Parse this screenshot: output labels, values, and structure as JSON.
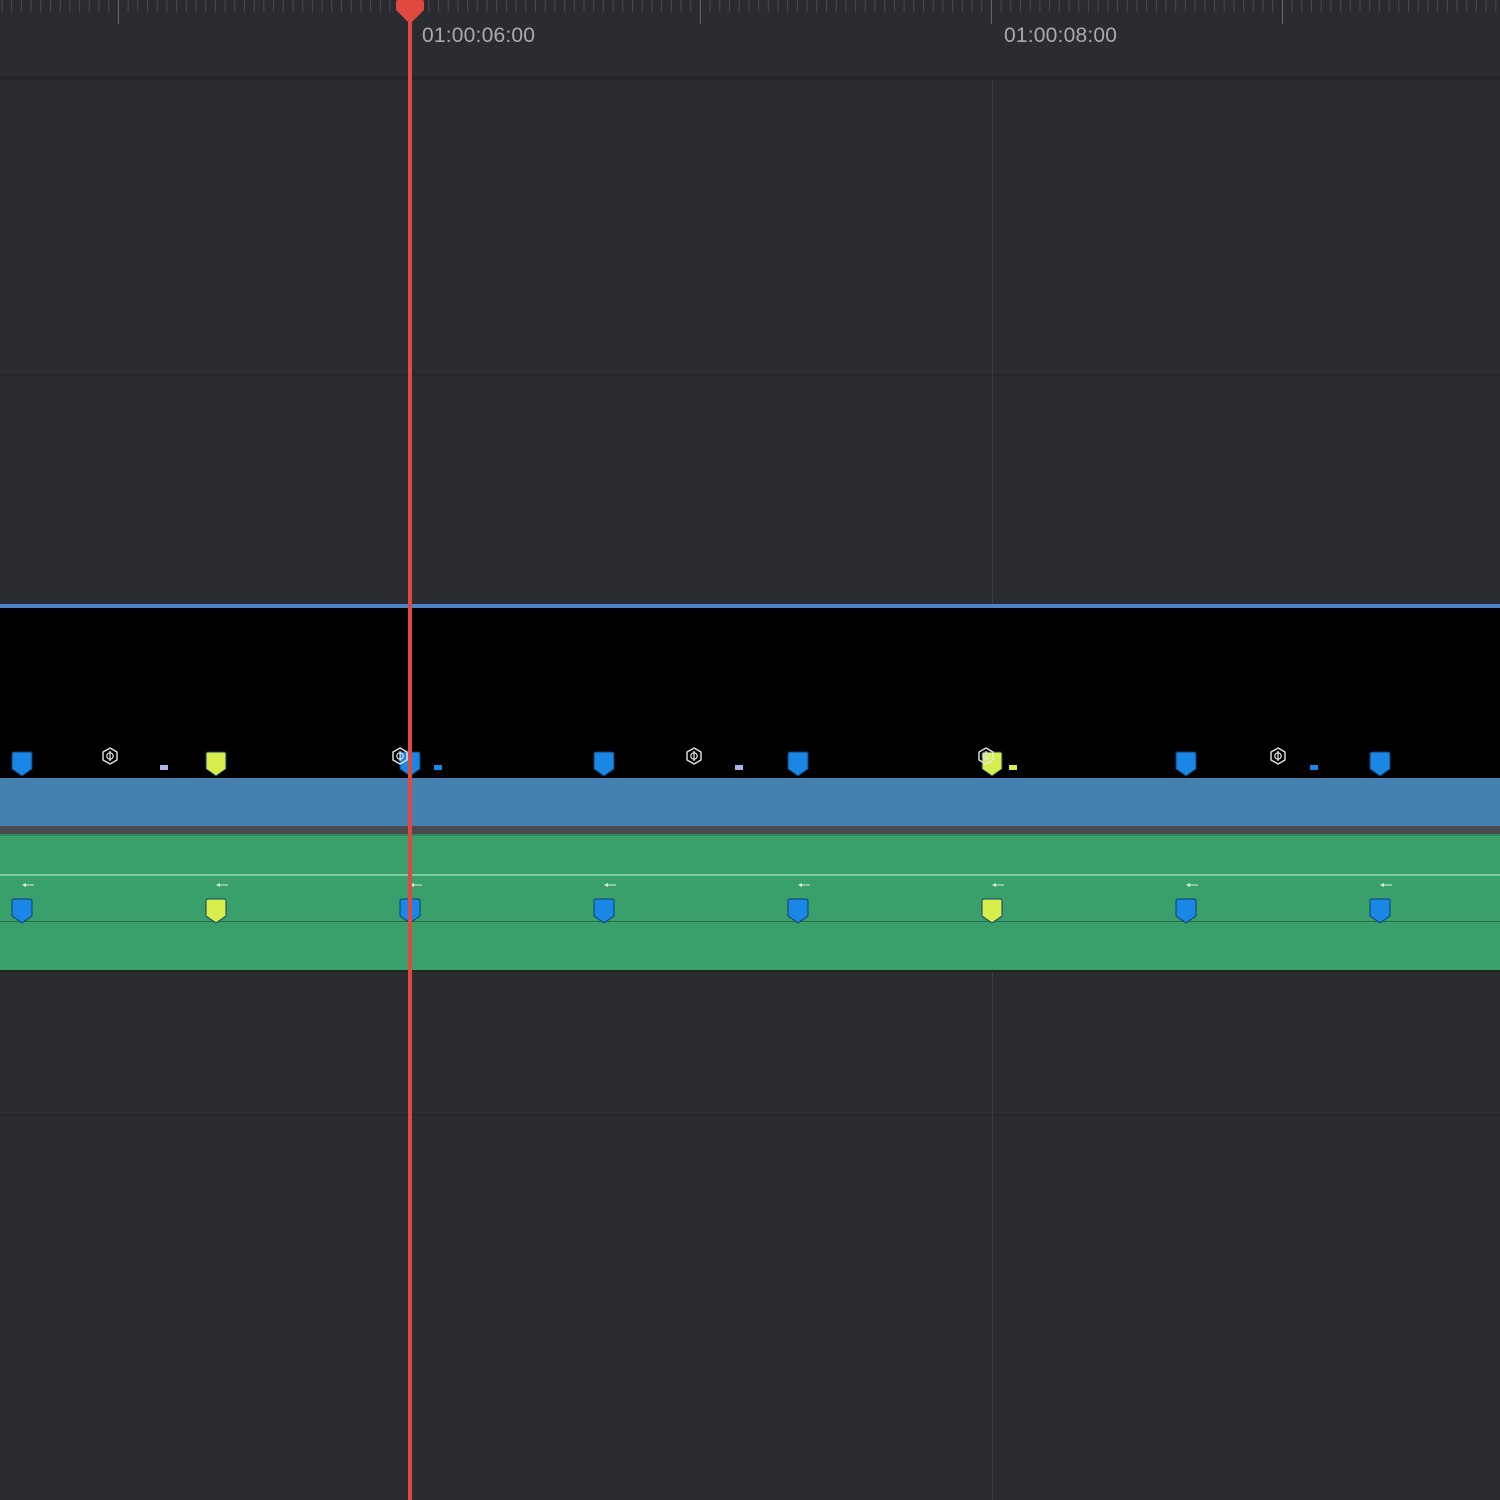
{
  "ruler": {
    "timecodes": [
      "01:00:06:00",
      "01:00:08:00"
    ]
  },
  "colors": {
    "background": "#2b2c32",
    "playhead": "#e0493f",
    "video_clip": "#4580b1",
    "audio_clip": "#39a06b",
    "marker_blue": "#1a86e6",
    "marker_yellow": "#d8ee4a"
  },
  "icons": {
    "fx": "hexagon-fx-icon",
    "marker": "marker-flag-icon",
    "playhead": "playhead-icon"
  },
  "markers": {
    "video": [
      "blue",
      "yellow",
      "blue",
      "blue",
      "blue",
      "yellow",
      "blue",
      "blue"
    ],
    "audio": [
      "blue",
      "yellow",
      "blue",
      "blue",
      "blue",
      "yellow",
      "blue",
      "blue"
    ]
  }
}
